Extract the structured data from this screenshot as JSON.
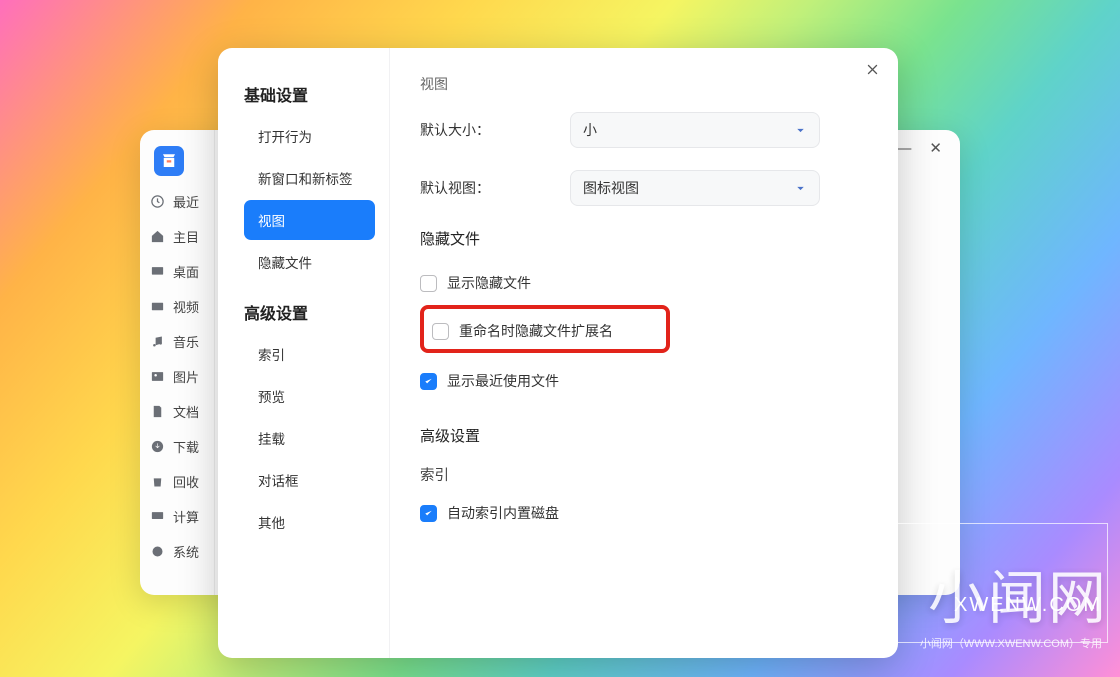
{
  "backWindow": {
    "sidebar": [
      {
        "icon": "clock",
        "label": "最近"
      },
      {
        "icon": "home",
        "label": "主目"
      },
      {
        "icon": "desktop",
        "label": "桌面"
      },
      {
        "icon": "video",
        "label": "视频"
      },
      {
        "icon": "music",
        "label": "音乐"
      },
      {
        "icon": "image",
        "label": "图片"
      },
      {
        "icon": "document",
        "label": "文档"
      },
      {
        "icon": "download",
        "label": "下载"
      },
      {
        "icon": "trash",
        "label": "回收"
      },
      {
        "icon": "computer",
        "label": "计算"
      },
      {
        "icon": "disk",
        "label": "系统"
      }
    ],
    "titlebarClose": "✕"
  },
  "modal": {
    "nav": {
      "group1": {
        "title": "基础设置",
        "items": [
          "打开行为",
          "新窗口和新标签",
          "视图",
          "隐藏文件"
        ],
        "activeIndex": 2
      },
      "group2": {
        "title": "高级设置",
        "items": [
          "索引",
          "预览",
          "挂载",
          "对话框",
          "其他"
        ]
      }
    },
    "content": {
      "partialHeading": "视图",
      "defaultSize": {
        "label": "默认大小：",
        "value": "小"
      },
      "defaultView": {
        "label": "默认视图：",
        "value": "图标视图"
      },
      "hiddenFiles": {
        "title": "隐藏文件",
        "showHidden": {
          "label": "显示隐藏文件",
          "checked": false
        },
        "hideExtOnRename": {
          "label": "重命名时隐藏文件扩展名",
          "checked": false
        },
        "showRecent": {
          "label": "显示最近使用文件",
          "checked": true
        }
      },
      "advanced": {
        "title": "高级设置",
        "indexTitle": "索引",
        "autoIndex": {
          "label": "自动索引内置磁盘",
          "checked": true
        }
      }
    }
  },
  "watermark": {
    "main": "小闻网",
    "domain": "XWENW.COM",
    "footer": "小闻网（WWW.XWENW.COM）专用",
    "side": "XWENW.COM"
  }
}
